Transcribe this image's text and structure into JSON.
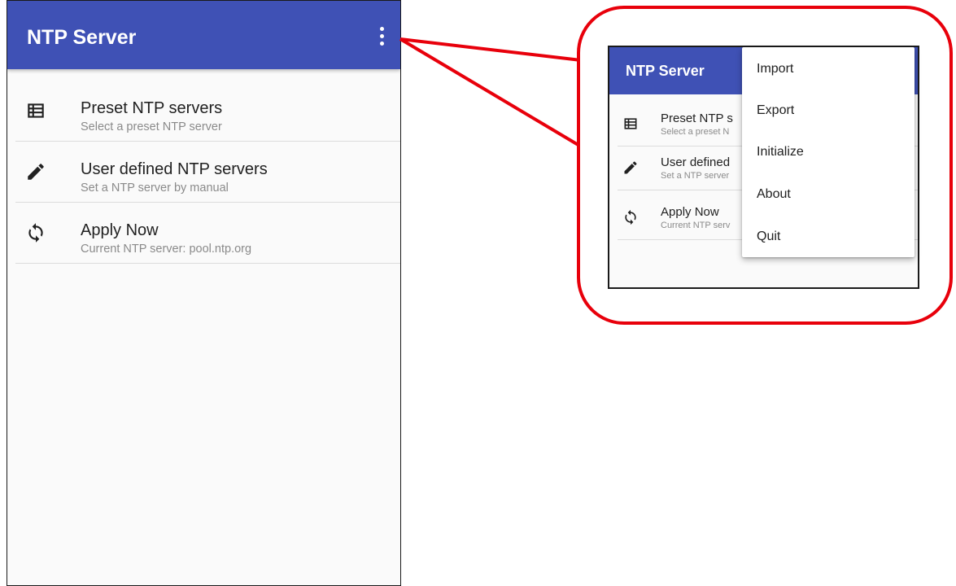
{
  "app": {
    "title": "NTP Server"
  },
  "list": {
    "items": [
      {
        "icon": "list-icon",
        "title": "Preset NTP servers",
        "subtitle": "Select a preset NTP server"
      },
      {
        "icon": "pencil-icon",
        "title": "User defined NTP servers",
        "subtitle": "Set a NTP server by manual"
      },
      {
        "icon": "sync-icon",
        "title": "Apply Now",
        "subtitle": "Current NTP server: pool.ntp.org"
      }
    ]
  },
  "mini": {
    "title": "NTP Server",
    "items": [
      {
        "title": "Preset NTP s",
        "subtitle": "Select a preset N"
      },
      {
        "title": "User defined",
        "subtitle": "Set a NTP server"
      },
      {
        "title": "Apply Now",
        "subtitle": "Current NTP serv"
      }
    ]
  },
  "menu": {
    "items": [
      "Import",
      "Export",
      "Initialize",
      "About",
      "Quit"
    ]
  },
  "colors": {
    "appbar": "#3f51b5",
    "callout_border": "#e8000b",
    "background": "#fafafa"
  }
}
